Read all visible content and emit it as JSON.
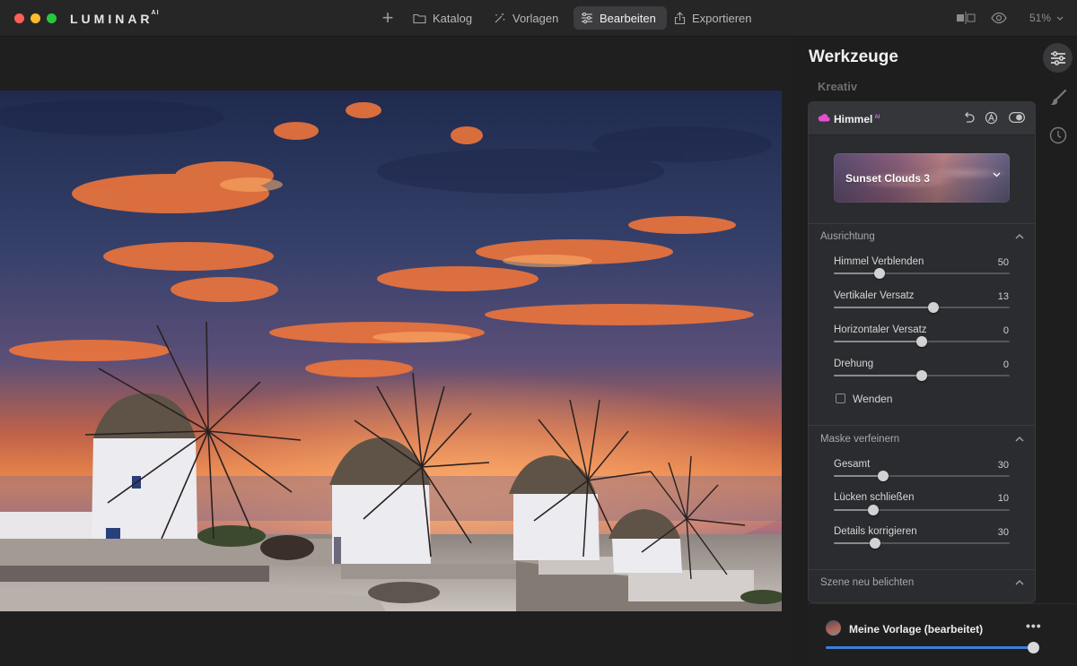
{
  "app": {
    "brand": "LUMINAR",
    "brand_sup": "AI"
  },
  "toolbar": {
    "add_label": "+",
    "nav": [
      {
        "label": "Katalog",
        "icon": "folder-icon"
      },
      {
        "label": "Vorlagen",
        "icon": "magic-wand-icon"
      },
      {
        "label": "Bearbeiten",
        "icon": "sliders-icon",
        "active": true
      },
      {
        "label": "Exportieren",
        "icon": "share-icon"
      }
    ],
    "zoom": "51%"
  },
  "panel": {
    "title": "Werkzeuge",
    "section": "Kreativ",
    "tool": {
      "title": "Himmel",
      "title_sup": "AI",
      "sky_preset": "Sunset Clouds 3",
      "groups": [
        {
          "title": "Ausrichtung",
          "sliders": [
            {
              "label": "Himmel Verblenden",
              "value": "50",
              "pos": 0.26
            },
            {
              "label": "Vertikaler Versatz",
              "value": "13",
              "pos": 0.565
            },
            {
              "label": "Horizontaler Versatz",
              "value": "0",
              "pos": 0.5
            },
            {
              "label": "Drehung",
              "value": "0",
              "pos": 0.5
            }
          ],
          "checkbox": {
            "label": "Wenden",
            "checked": false
          }
        },
        {
          "title": "Maske verfeinern",
          "sliders": [
            {
              "label": "Gesamt",
              "value": "30",
              "pos": 0.28
            },
            {
              "label": "Lücken schließen",
              "value": "10",
              "pos": 0.225
            },
            {
              "label": "Details korrigieren",
              "value": "30",
              "pos": 0.235
            }
          ]
        },
        {
          "title": "Szene neu belichten"
        }
      ]
    }
  },
  "preset_bar": {
    "name": "Meine Vorlage (bearbeitet)",
    "more": "•••",
    "amount": 1.0
  },
  "colors": {
    "accent_blue": "#3e7de0",
    "ai_magenta": "#d86fe0",
    "panel_bg": "#2b2c2f"
  }
}
